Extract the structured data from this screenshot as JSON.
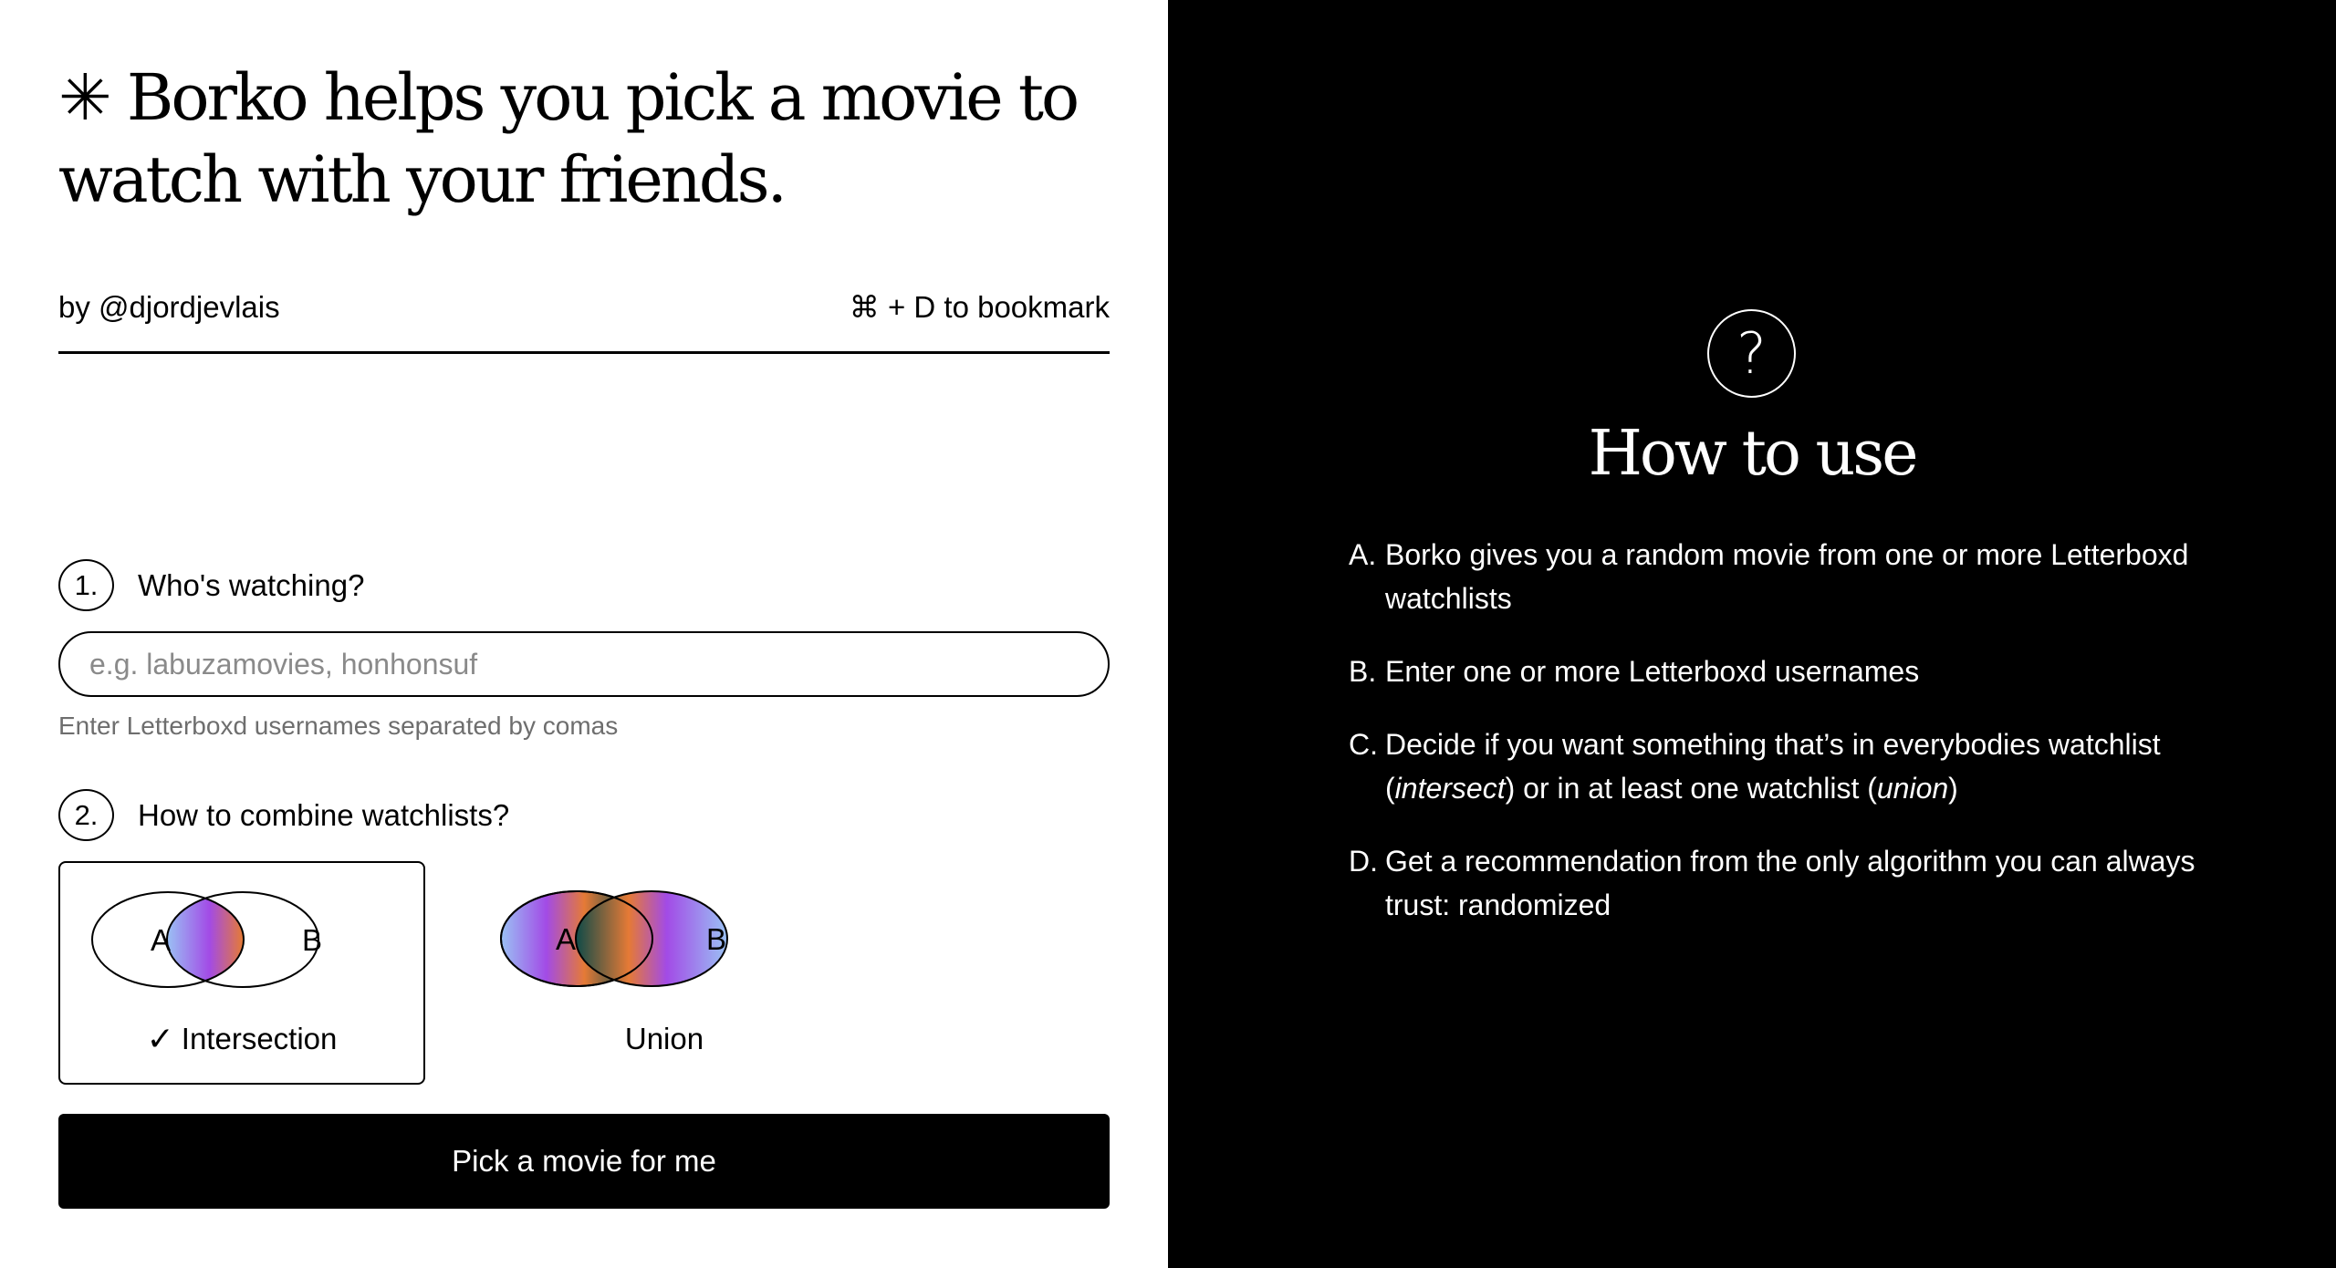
{
  "header": {
    "title_mark": "✳",
    "title": "Borko helps you pick a movie to watch with your friends.",
    "author": "by @djordjevlais",
    "bookmark_hint": "⌘ + D to bookmark"
  },
  "step1": {
    "number": "1.",
    "label": "Who's watching?",
    "placeholder": "e.g. labuzamovies, honhonsuf",
    "value": "",
    "hint": "Enter Letterboxd usernames separated by comas"
  },
  "step2": {
    "number": "2.",
    "label": "How to combine watchlists?",
    "options": [
      {
        "label": "Intersection",
        "selected": true,
        "circle_a": "A",
        "circle_b": "B"
      },
      {
        "label": "Union",
        "selected": false,
        "circle_a": "A",
        "circle_b": "B"
      }
    ]
  },
  "submit_label": "Pick a movie for me",
  "help": {
    "icon": "question-mark-icon",
    "title": "How to use",
    "items": [
      {
        "letter": "A.",
        "text": "Borko gives you a random movie from one or more Letterboxd watchlists"
      },
      {
        "letter": "B.",
        "text": "Enter one or more Letterboxd usernames"
      },
      {
        "letter": "C.",
        "pre": "Decide if you want something that’s in everybodies watchlist (",
        "em1": "intersect",
        "mid": ") or in at least one watchlist (",
        "em2": "union",
        "post": ")"
      },
      {
        "letter": "D.",
        "text": "Get a recommendation from the only algorithm you can always trust: randomized"
      }
    ]
  },
  "colors": {
    "background_left": "#ffffff",
    "background_right": "#000000",
    "hint_text": "#6e6e6e",
    "gradient": [
      "#9ac1f4",
      "#a24be6",
      "#e57a36",
      "#0e4a48"
    ]
  }
}
